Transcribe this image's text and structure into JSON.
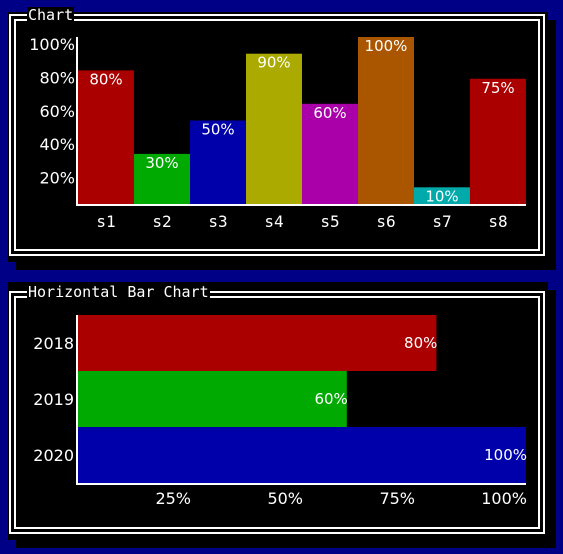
{
  "colors": {
    "background_dots": "#0000a8",
    "panel_bg": "#000000",
    "border": "#ffffff",
    "text": "#ffffff"
  },
  "chart_data": [
    {
      "type": "bar",
      "orientation": "vertical",
      "title": "Chart",
      "categories": [
        "s1",
        "s2",
        "s3",
        "s4",
        "s5",
        "s6",
        "s7",
        "s8"
      ],
      "values": [
        80,
        30,
        50,
        90,
        60,
        100,
        10,
        75
      ],
      "value_labels": [
        "80%",
        "30%",
        "50%",
        "90%",
        "60%",
        "100%",
        "10%",
        "75%"
      ],
      "bar_colors": [
        "#aa0000",
        "#00aa00",
        "#0000aa",
        "#aaaa00",
        "#aa00aa",
        "#aa5500",
        "#00aaaa",
        "#aa0000"
      ],
      "yticks": [
        100,
        80,
        60,
        40,
        20
      ],
      "ytick_labels": [
        "100%",
        "80%",
        "60%",
        "40%",
        "20%"
      ],
      "ylim": [
        0,
        100
      ],
      "xlabel": "",
      "ylabel": "",
      "grid": false,
      "legend": "none"
    },
    {
      "type": "bar",
      "orientation": "horizontal",
      "title": "Horizontal Bar Chart",
      "categories": [
        "2018",
        "2019",
        "2020"
      ],
      "values": [
        80,
        60,
        100
      ],
      "value_labels": [
        "80%",
        "60%",
        "100%"
      ],
      "bar_colors": [
        "#aa0000",
        "#00aa00",
        "#0000aa"
      ],
      "xticks": [
        25,
        50,
        75,
        100
      ],
      "xtick_labels": [
        "25%",
        "50%",
        "75%",
        "100%"
      ],
      "xlim": [
        0,
        100
      ],
      "xlabel": "",
      "ylabel": "",
      "grid": false,
      "legend": "none"
    }
  ]
}
